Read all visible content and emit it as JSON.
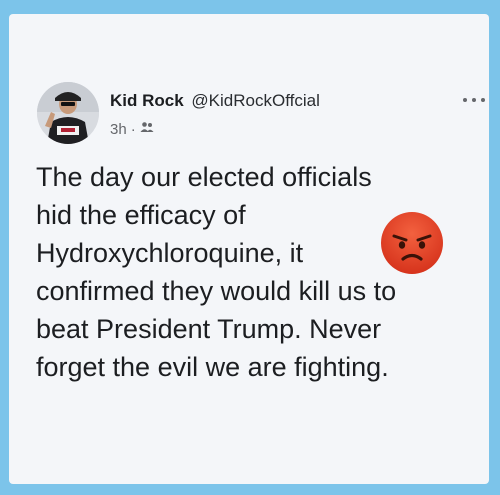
{
  "post": {
    "author_name": "Kid Rock",
    "author_handle": "@KidRockOffcial",
    "time": "3h",
    "separator": "·",
    "privacy_icon": "friends-icon",
    "more_icon": "more-options-icon",
    "lines": [
      "The day our elected officials",
      "hid the efficacy of",
      "Hydroxychloroquine, it",
      "confirmed they would kill us to",
      "beat President Trump. Never",
      "forget the evil we are fighting."
    ],
    "emoji": "angry-face-icon"
  },
  "colors": {
    "frame": "#7cc4ea",
    "card": "#f4f6f9",
    "text": "#1c1e21",
    "meta": "#65676b",
    "emoji_face": "#e8432a"
  }
}
